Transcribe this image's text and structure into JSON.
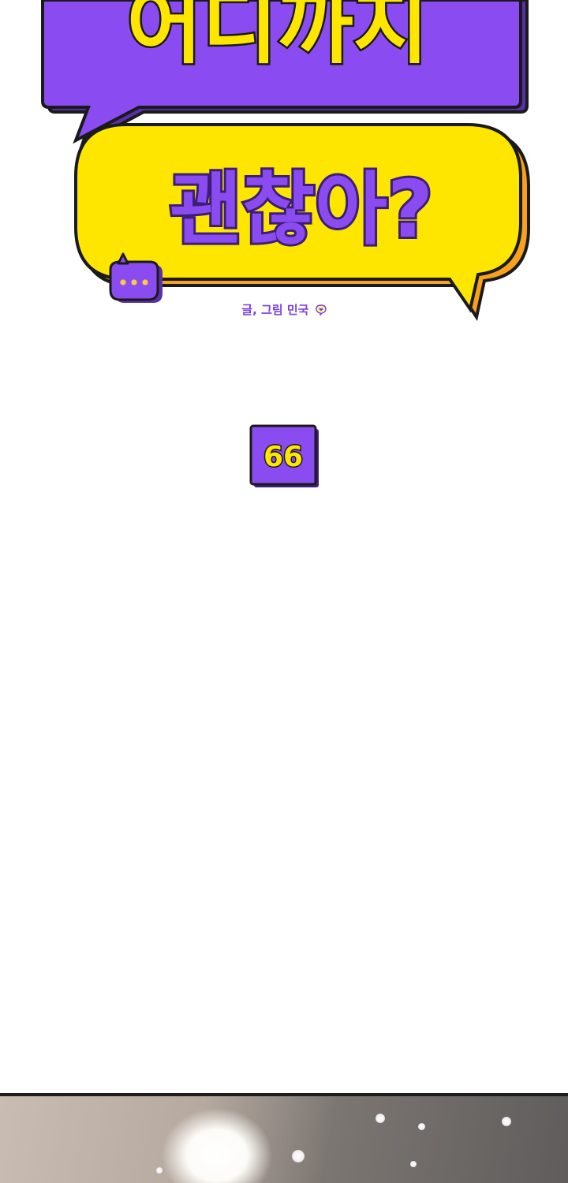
{
  "title": {
    "line1": "어디까지",
    "line2": "괜찮아?"
  },
  "credit": "글, 그림 민국",
  "episode": "66",
  "colors": {
    "purple": "#8a4cf0",
    "yellow": "#ffe600",
    "orange": "#f7a21c",
    "outline": "#1a1a1a"
  },
  "icons": [
    "speech-bubble-icon",
    "heart-bubble-icon"
  ]
}
